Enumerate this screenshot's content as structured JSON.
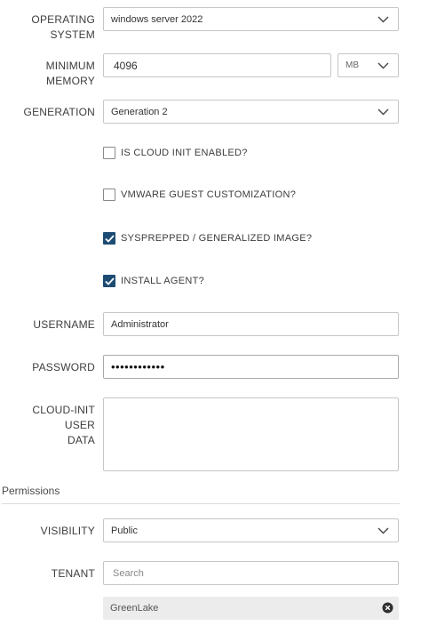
{
  "form": {
    "os": {
      "label_line1": "OPERATING",
      "label_line2": "SYSTEM",
      "value": "windows server 2022"
    },
    "memory": {
      "label_line1": "MINIMUM",
      "label_line2": "MEMORY",
      "value": "4096",
      "unit": "MB"
    },
    "generation": {
      "label": "GENERATION",
      "value": "Generation 2"
    },
    "checkboxes": [
      {
        "label": "IS CLOUD INIT ENABLED?",
        "checked": false
      },
      {
        "label": "VMWARE GUEST CUSTOMIZATION?",
        "checked": false
      },
      {
        "label": "SYSPREPPED / GENERALIZED IMAGE?",
        "checked": true
      },
      {
        "label": "INSTALL AGENT?",
        "checked": true
      }
    ],
    "username": {
      "label": "USERNAME",
      "value": "Administrator"
    },
    "password": {
      "label": "PASSWORD",
      "value": "••••••••••••"
    },
    "cloud_init": {
      "label_line1": "CLOUD-INIT USER",
      "label_line2": "DATA",
      "value": ""
    }
  },
  "permissions": {
    "title": "Permissions",
    "visibility": {
      "label": "VISIBILITY",
      "value": "Public"
    },
    "tenant": {
      "label": "TENANT",
      "placeholder": "Search",
      "selected": "GreenLake"
    }
  },
  "colors": {
    "checkbox_checked": "#1d4c73",
    "border": "#c6c6c6",
    "tag_bg": "#ececec"
  },
  "icons": {
    "dropdown": "chevron-down-icon",
    "check": "check-icon",
    "remove": "close-circle-icon"
  }
}
